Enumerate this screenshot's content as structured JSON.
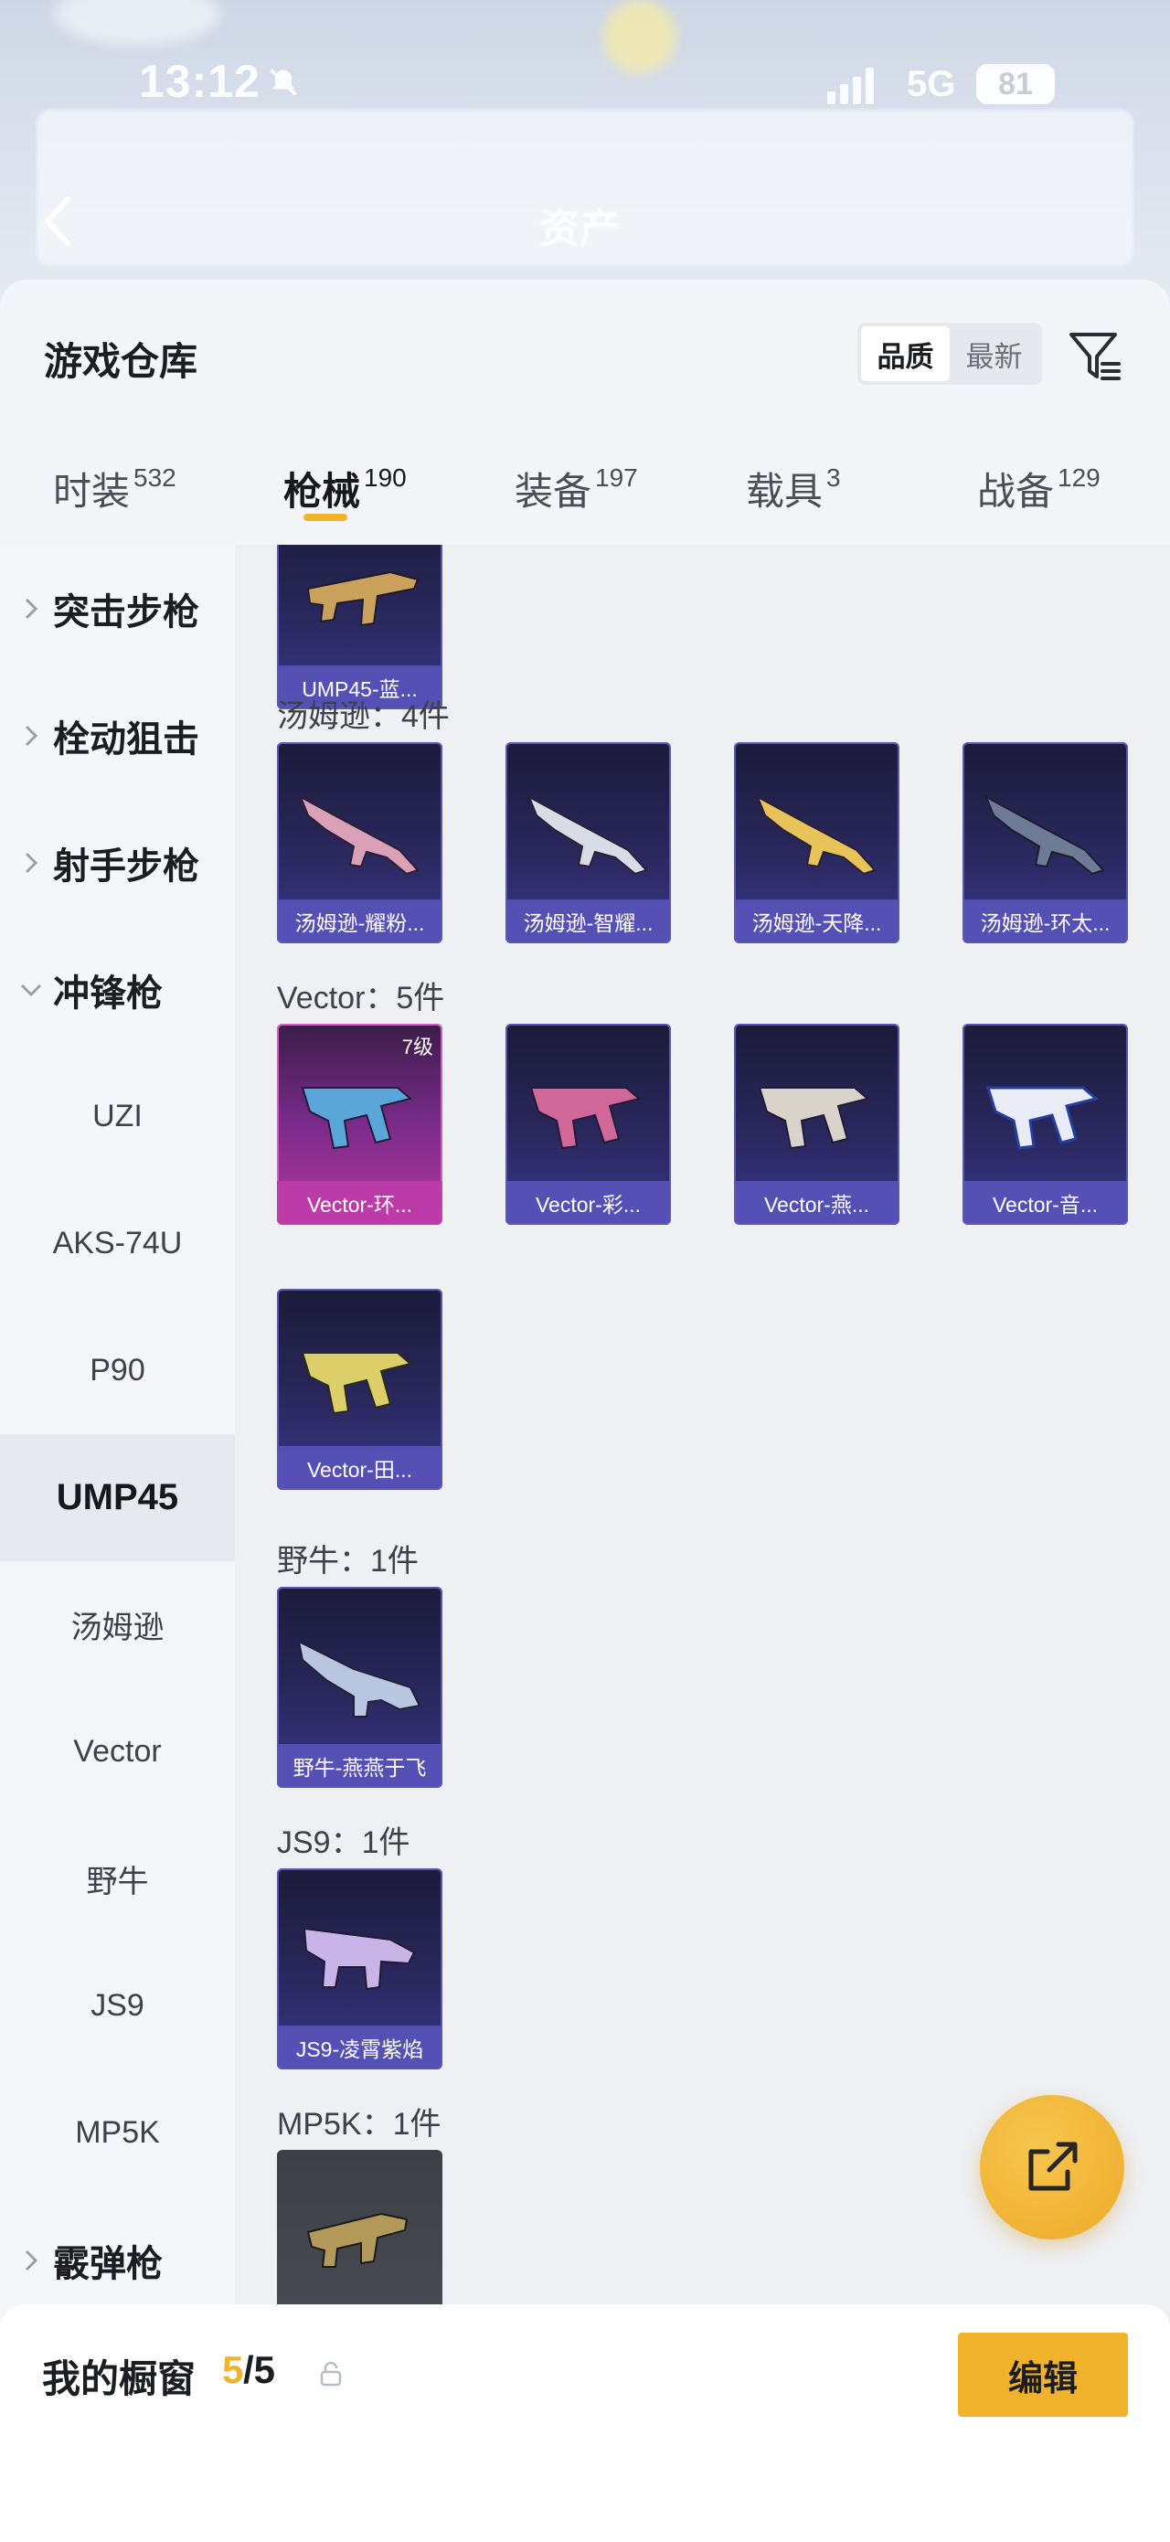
{
  "status_bar": {
    "time": "13:12",
    "network": "5G",
    "battery": "81"
  },
  "background": {
    "title": "资产"
  },
  "sheet": {
    "title": "游戏仓库",
    "sort_options": [
      "品质",
      "最新"
    ],
    "sort_selected": "品质"
  },
  "tabs": [
    {
      "label": "时装",
      "count": "532"
    },
    {
      "label": "枪械",
      "count": "190"
    },
    {
      "label": "装备",
      "count": "197"
    },
    {
      "label": "载具",
      "count": "3"
    },
    {
      "label": "战备",
      "count": "129"
    }
  ],
  "active_tab": "枪械",
  "sidebar": {
    "groups": [
      "突击步枪",
      "栓动狙击",
      "射手步枪",
      "冲锋枪"
    ],
    "smg_items": [
      "UZI",
      "AKS-74U",
      "P90",
      "UMP45",
      "汤姆逊",
      "Vector",
      "野牛",
      "JS9",
      "MP5K"
    ],
    "next_group": "霰弹枪",
    "selected": "UMP45"
  },
  "content": {
    "top_card": {
      "name": "UMP45-蓝..."
    },
    "groups": [
      {
        "header": "汤姆逊：4件",
        "items": [
          {
            "name": "汤姆逊-耀粉..."
          },
          {
            "name": "汤姆逊-智耀..."
          },
          {
            "name": "汤姆逊-天降..."
          },
          {
            "name": "汤姆逊-环太..."
          }
        ]
      },
      {
        "header": "Vector：5件",
        "items": [
          {
            "name": "Vector-环...",
            "level": "7级"
          },
          {
            "name": "Vector-彩..."
          },
          {
            "name": "Vector-燕..."
          },
          {
            "name": "Vector-音..."
          },
          {
            "name": "Vector-田..."
          }
        ]
      },
      {
        "header": "野牛：1件",
        "items": [
          {
            "name": "野牛-燕燕于飞"
          }
        ]
      },
      {
        "header": "JS9：1件",
        "items": [
          {
            "name": "JS9-凌霄紫焰"
          }
        ]
      },
      {
        "header": "MP5K：1件",
        "items": []
      }
    ]
  },
  "bottom_bar": {
    "label": "我的橱窗",
    "count": "5",
    "total": "/5",
    "edit_label": "编辑"
  },
  "colors": {
    "accent": "#f1b22c",
    "card_blue": "#3a3588",
    "card_pink": "#b6379a"
  }
}
